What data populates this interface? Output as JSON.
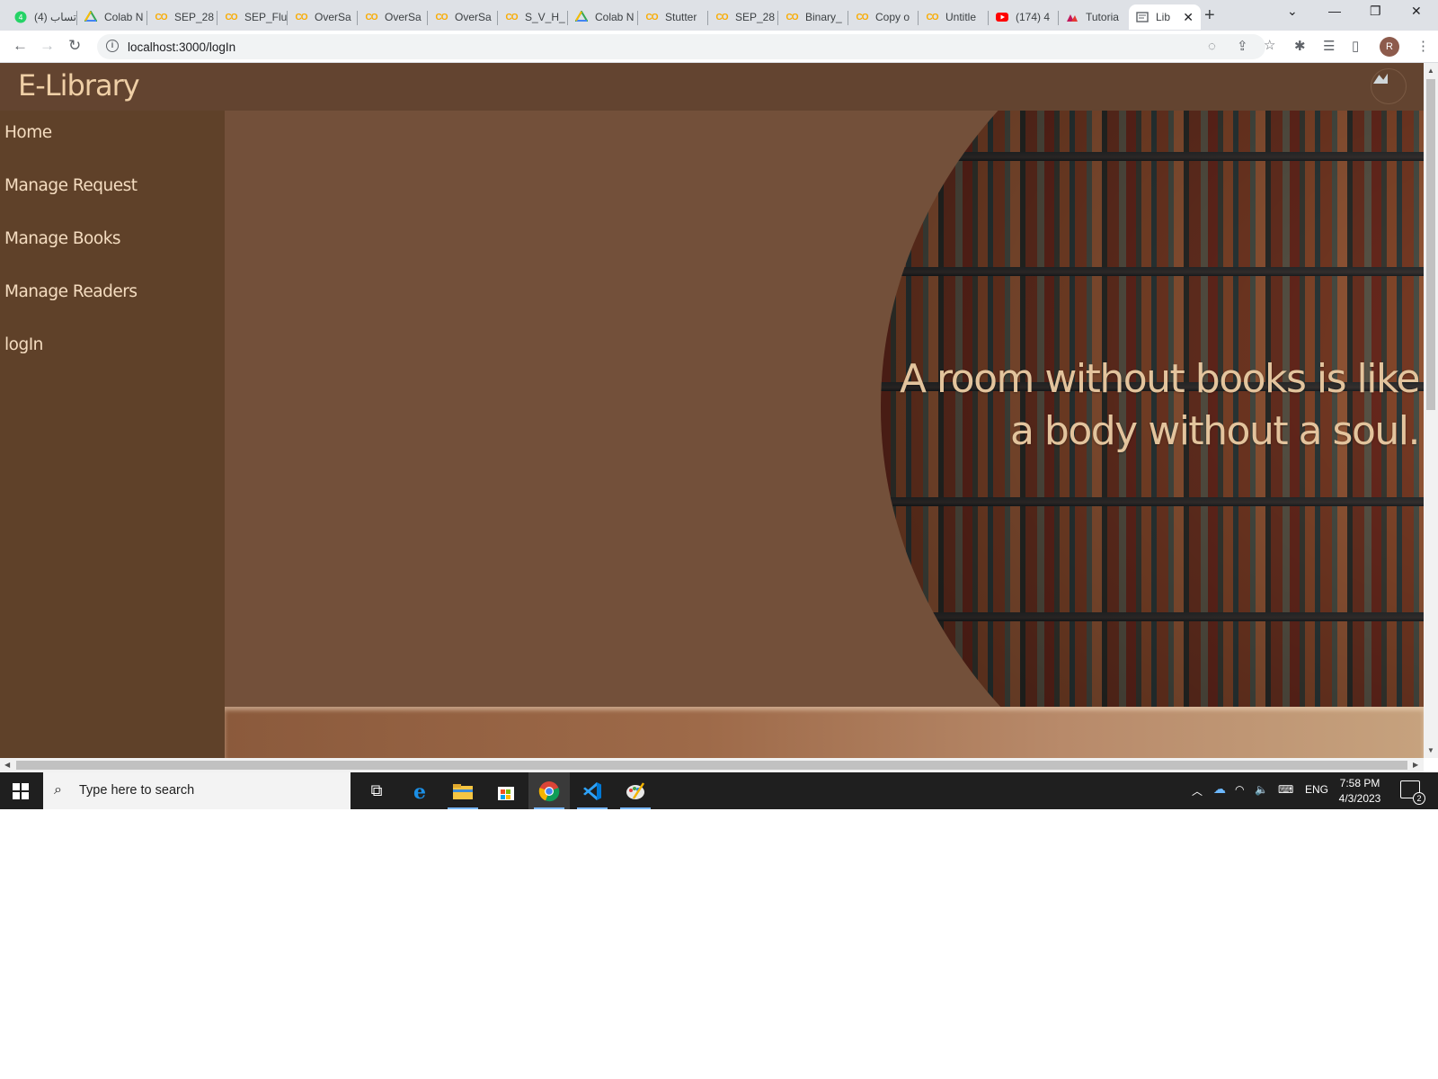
{
  "browser": {
    "tabs": [
      {
        "label": "(4) واتساب",
        "icon": "whatsapp-icon"
      },
      {
        "label": "Colab N",
        "icon": "google-drive-icon"
      },
      {
        "label": "SEP_28",
        "icon": "colab-icon"
      },
      {
        "label": "SEP_Flu",
        "icon": "colab-icon"
      },
      {
        "label": "OverSa",
        "icon": "colab-icon"
      },
      {
        "label": "OverSa",
        "icon": "colab-icon"
      },
      {
        "label": "OverSa",
        "icon": "colab-icon"
      },
      {
        "label": "S_V_H_",
        "icon": "colab-icon"
      },
      {
        "label": "Colab N",
        "icon": "google-drive-icon"
      },
      {
        "label": "Stutter",
        "icon": "colab-icon"
      },
      {
        "label": "SEP_28",
        "icon": "colab-icon"
      },
      {
        "label": "Binary_",
        "icon": "colab-icon"
      },
      {
        "label": "Copy o",
        "icon": "colab-icon"
      },
      {
        "label": "Untitle",
        "icon": "colab-icon"
      },
      {
        "label": "(174) 4",
        "icon": "youtube-icon"
      },
      {
        "label": "Tutoria",
        "icon": "tutorial-icon"
      },
      {
        "label": "Lib",
        "icon": "page-icon",
        "active": true
      }
    ],
    "new_tab": "+",
    "url": "localhost:3000/logIn",
    "profile_initial": "R"
  },
  "app": {
    "brand": "E-Library",
    "nav": [
      {
        "label": "Home"
      },
      {
        "label": "Manage Request"
      },
      {
        "label": "Manage Books"
      },
      {
        "label": "Manage Readers"
      },
      {
        "label": "logIn"
      }
    ],
    "quote_line1": "A room without books is like",
    "quote_line2": "a body without a soul."
  },
  "taskbar": {
    "search_placeholder": "Type here to search",
    "language": "ENG",
    "time": "7:58 PM",
    "date": "4/3/2023",
    "notification_count": "2"
  },
  "colors": {
    "header": "#634430",
    "sidebar": "#5f4129",
    "main": "#73503a",
    "brand_text": "#efcfa6",
    "quote_text": "#e3c49d"
  }
}
